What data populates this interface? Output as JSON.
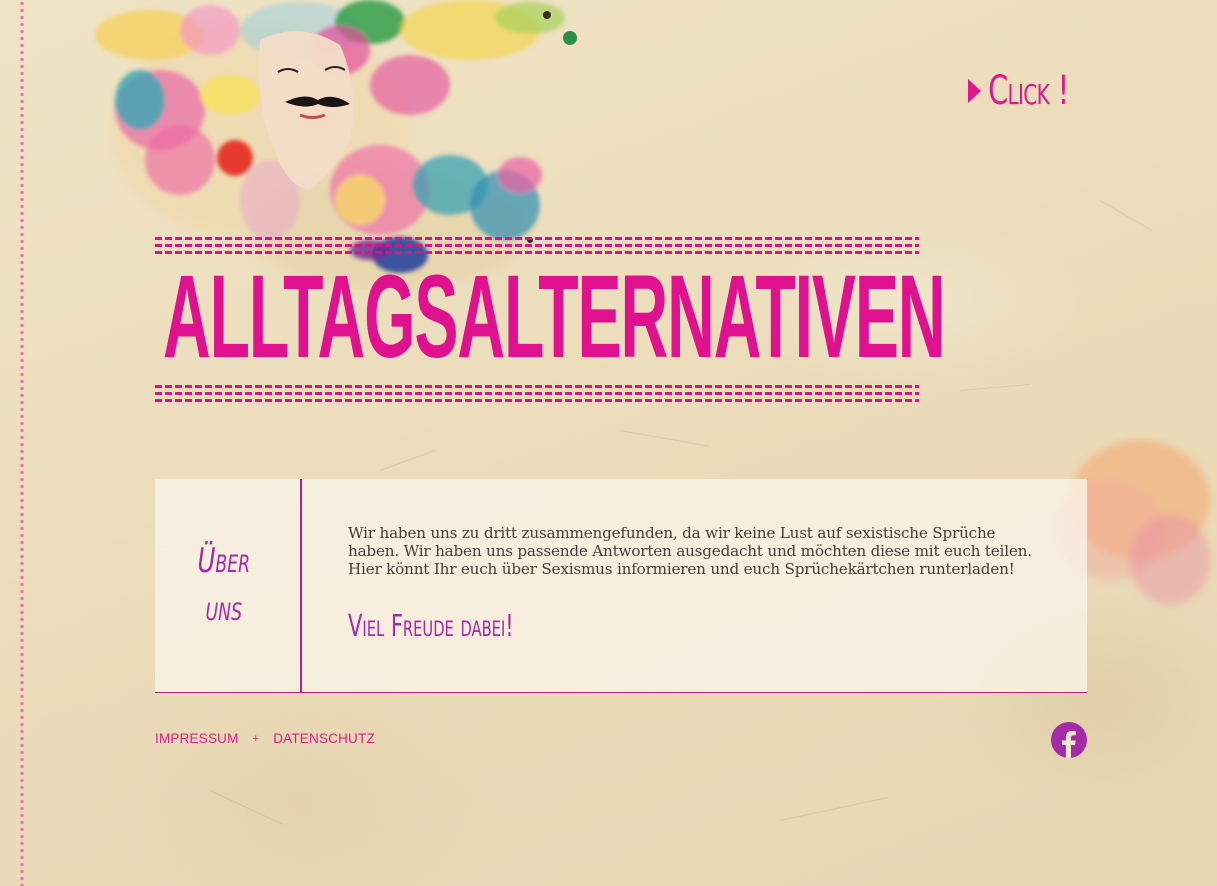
{
  "header": {
    "click_label": "Click !",
    "site_title": "ALLTAGSALTERNATIVEN"
  },
  "about": {
    "heading_line1": "Über",
    "heading_line2": "uns",
    "text": "Wir haben uns zu dritt zusammengefunden, da wir keine Lust auf sexistische Sprüche haben. Wir haben uns passende Antworten ausgedacht und möchten diese mit euch teilen. Hier könnt Ihr euch über Sexismus informieren und euch Sprüchekärtchen runterladen!",
    "slogan": "Viel Freude dabei!"
  },
  "footer": {
    "impressum": "IMPRESSUM",
    "separator": "+",
    "datenschutz": "DATENSCHUTZ"
  },
  "icons": {
    "social": "facebook-icon",
    "click_arrow": "play-triangle-icon"
  },
  "colors": {
    "accent_pink": "#e0118f",
    "purple": "#a52aa5",
    "paper": "#ede0c0"
  }
}
